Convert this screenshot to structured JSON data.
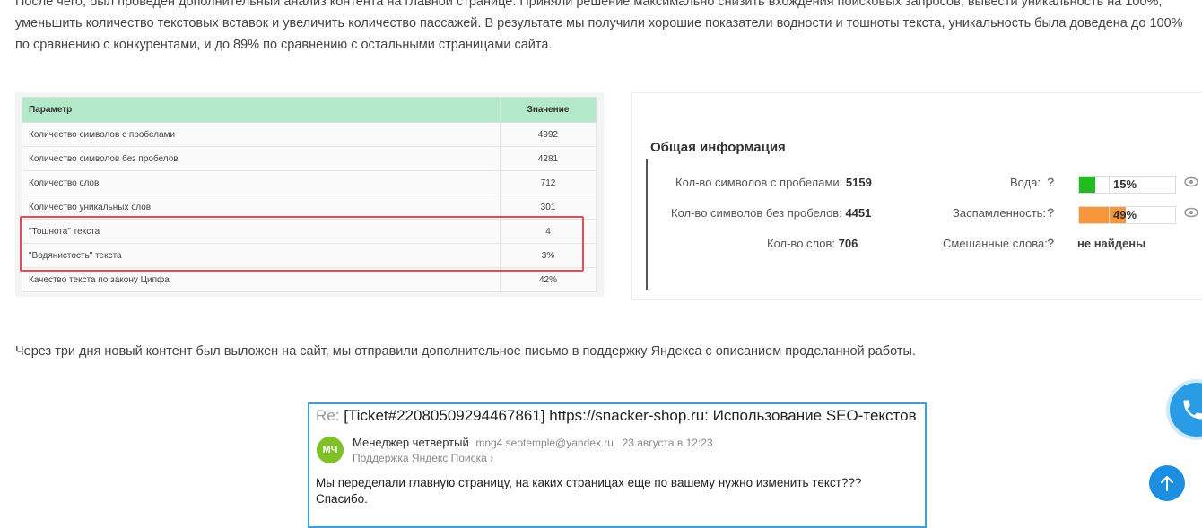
{
  "article": {
    "para1_line1": "После чего, был проведен дополнительный анализ контента на главной странице. Приняли решение максимально снизить вхождения поисковых запросов, вывести уникальность на 100%,",
    "para1_line2": "уменьшить количество текстовых вставок и увеличить количество пассажей. В результате мы получили хорошие показатели водности и тошноты текста, уникальность была доведена до 100%",
    "para1_line3": "по сравнению с конкурентами, и до 89% по сравнению с остальными страницами сайта.",
    "para2": "Через три дня новый контент был выложен на сайт, мы отправили дополнительное письмо в поддержку Яндекса с описанием проделанной работы."
  },
  "param_table": {
    "headers": [
      "Параметр",
      "Значение"
    ],
    "rows": [
      [
        "Количество символов с пробелами",
        "4992"
      ],
      [
        "Количество символов без пробелов",
        "4281"
      ],
      [
        "Количество слов",
        "712"
      ],
      [
        "Количество уникальных слов",
        "301"
      ],
      [
        "\"Тошнота\" текста",
        "4"
      ],
      [
        "\"Водянистость\" текста",
        "3%"
      ],
      [
        "Качество текста по закону Ципфа",
        "42%"
      ]
    ],
    "highlight_color": "#e24e54"
  },
  "info_panel": {
    "title": "Общая информация",
    "chars_with_spaces_label": "Кол-во символов с пробелами:",
    "chars_with_spaces_value": "5159",
    "chars_without_spaces_label": "Кол-во символов без пробелов:",
    "chars_without_spaces_value": "4451",
    "words_label": "Кол-во слов:",
    "words_value": "706",
    "water_label": "Вода:",
    "water_value": "15%",
    "water_fraction": 0.15,
    "water_color": "#22bb22",
    "spam_label": "Заспамленность:",
    "spam_value": "49%",
    "spam_fraction": 0.49,
    "spam_color": "#f7963a",
    "mixed_label": "Смешанные слова:",
    "mixed_value": "не найдены",
    "help_icon": "question-mark",
    "eye_icon": "eye"
  },
  "email": {
    "re": "Re:",
    "subject": "[Ticket#22080509294467861] https://snacker-shop.ru: Использование SEO-текстов",
    "avatar_initials": "МЧ",
    "sender_name": "Менеджер четвертый",
    "sender_email": "mng4.seotemple@yandex.ru",
    "date": "23 августа в 12:23",
    "recipient": "Поддержка Яндекс Поиска",
    "body_line1": "Мы переделали главную страницу, на каких страницах еще по вашему нужно изменить текст???",
    "body_line2": "Спасибо."
  },
  "widgets": {
    "phone_icon": "phone-icon",
    "scroll_top_icon": "arrow-up-icon"
  }
}
